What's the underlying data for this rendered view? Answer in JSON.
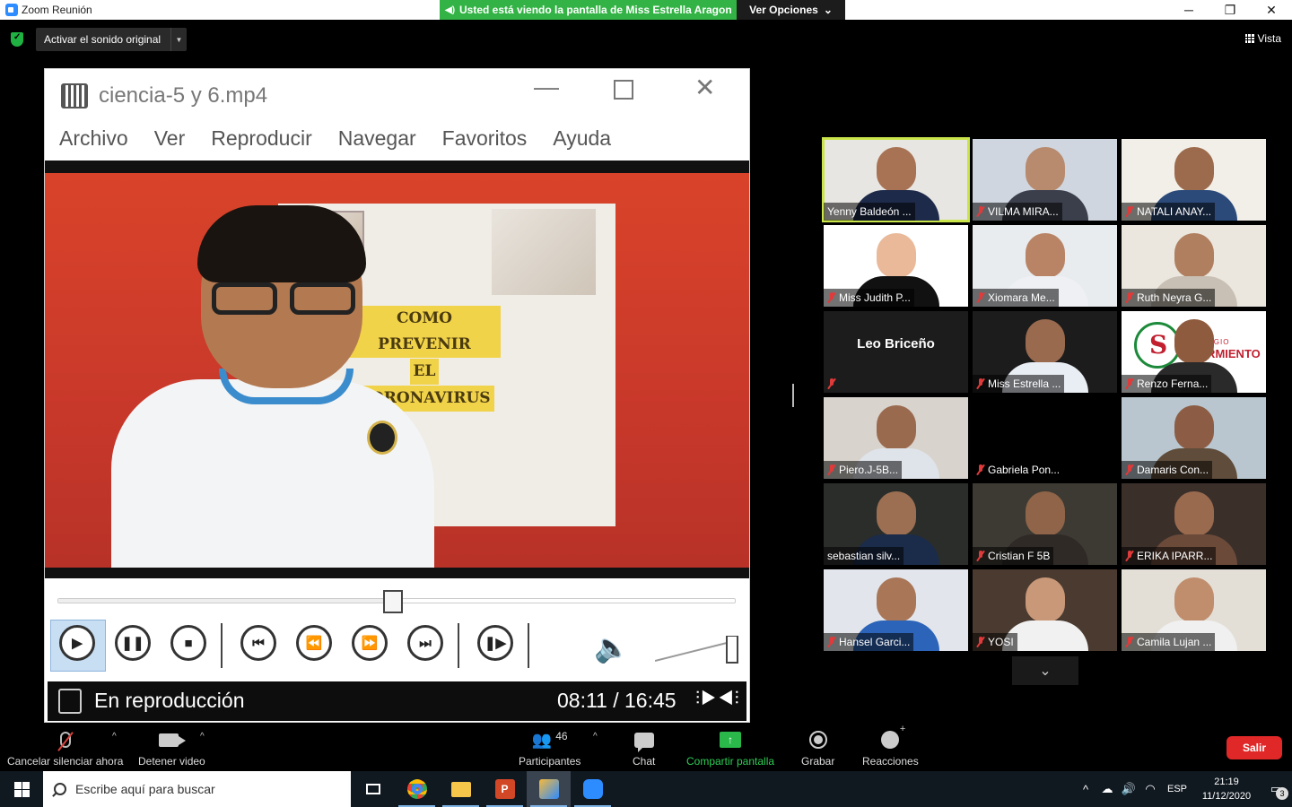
{
  "window": {
    "title": "Zoom Reunión",
    "share_banner": "Usted está viendo la pantalla de Miss Estrella Aragon",
    "view_options": "Ver Opciones",
    "minimize": "─",
    "maximize": "❐",
    "close": "✕"
  },
  "topbar": {
    "original_sound": "Activar el sonido original",
    "view": "Vista"
  },
  "player": {
    "file_name": "ciencia-5 y 6.mp4",
    "menu": [
      "Archivo",
      "Ver",
      "Reproducir",
      "Navegar",
      "Favoritos",
      "Ayuda"
    ],
    "poster_lines": [
      "COMO PREVENIR",
      "EL",
      "CORONAVIRUS"
    ],
    "progress": 0.4938,
    "status": "En reproducción",
    "time": "08:11 / 16:45"
  },
  "participants": [
    {
      "name": "Yenny Baldeón ...",
      "muted": false,
      "active": true,
      "bg": "#e8e6e2",
      "skin": "#a87354",
      "shirt": "#1d2a4a"
    },
    {
      "name": "VILMA MIRA...",
      "muted": true,
      "bg": "#cfd6df",
      "skin": "#b88a6e",
      "shirt": "#3b3f4c"
    },
    {
      "name": "NATALI ANAY...",
      "muted": true,
      "bg": "#f2efe8",
      "skin": "#9c6a4c",
      "shirt": "#2b4a7a"
    },
    {
      "name": "Miss Judith P...",
      "muted": true,
      "bg": "#ffffff",
      "skin": "#e9b99a",
      "shirt": "#111111"
    },
    {
      "name": "Xiomara Me...",
      "muted": true,
      "bg": "#e9ecef",
      "skin": "#b98466",
      "shirt": "#eef0f3"
    },
    {
      "name": "Ruth Neyra G...",
      "muted": true,
      "bg": "#ebe7df",
      "skin": "#b07f5f",
      "shirt": "#c8c0b4"
    },
    {
      "name": "",
      "center": "Leo Briceño",
      "muted": true,
      "bg": "#1c1c1c"
    },
    {
      "name": "Miss Estrella ...",
      "muted": true,
      "bg": "#1c1c1c",
      "skin": "#9a6a4f",
      "shirt": "#e9eef5"
    },
    {
      "name": "Renzo Ferna...",
      "muted": true,
      "bg": "#ffffff",
      "skin": "#8e5b3e",
      "shirt": "#2a2a2a"
    },
    {
      "name": "Piero.J-5B...",
      "muted": true,
      "bg": "#d8d3cd",
      "skin": "#9a6a4f",
      "shirt": "#dfe4ea"
    },
    {
      "name": "Gabriela Pon...",
      "muted": true,
      "bg": "#000000"
    },
    {
      "name": "Damaris Con...",
      "muted": true,
      "bg": "#b9c6cf",
      "skin": "#8c5d44",
      "shirt": "#5f4c3a"
    },
    {
      "name": "sebastian silv...",
      "muted": false,
      "bg": "#2a2d2a",
      "skin": "#9c6f52",
      "shirt": "#1b2b4a"
    },
    {
      "name": "Cristian F 5B",
      "muted": true,
      "bg": "#3d3a33",
      "skin": "#8f6448",
      "shirt": "#2f2a26"
    },
    {
      "name": "ERIKA IPARR...",
      "muted": true,
      "bg": "#3b2f2a",
      "skin": "#9a6a4f",
      "shirt": "#6b4a3a"
    },
    {
      "name": "Hansel Garci...",
      "muted": true,
      "bg": "#e2e6ec",
      "skin": "#a97657",
      "shirt": "#2b64b8"
    },
    {
      "name": "YOSI",
      "muted": true,
      "bg": "#4a3a30",
      "skin": "#c99878",
      "shirt": "#f1f1f1"
    },
    {
      "name": "Camila Lujan ...",
      "muted": true,
      "bg": "#e3dfd6",
      "skin": "#c08d6d",
      "shirt": "#f0f0f0"
    }
  ],
  "toolbar": {
    "mute": "Cancelar silenciar ahora",
    "video": "Detener video",
    "participants": "Participantes",
    "participants_count": "46",
    "chat": "Chat",
    "share": "Compartir pantalla",
    "record": "Grabar",
    "reactions": "Reacciones",
    "leave": "Salir"
  },
  "taskbar": {
    "search_placeholder": "Escribe aquí para buscar",
    "lang": "ESP",
    "time": "21:19",
    "date": "11/12/2020",
    "notifications": "3"
  }
}
